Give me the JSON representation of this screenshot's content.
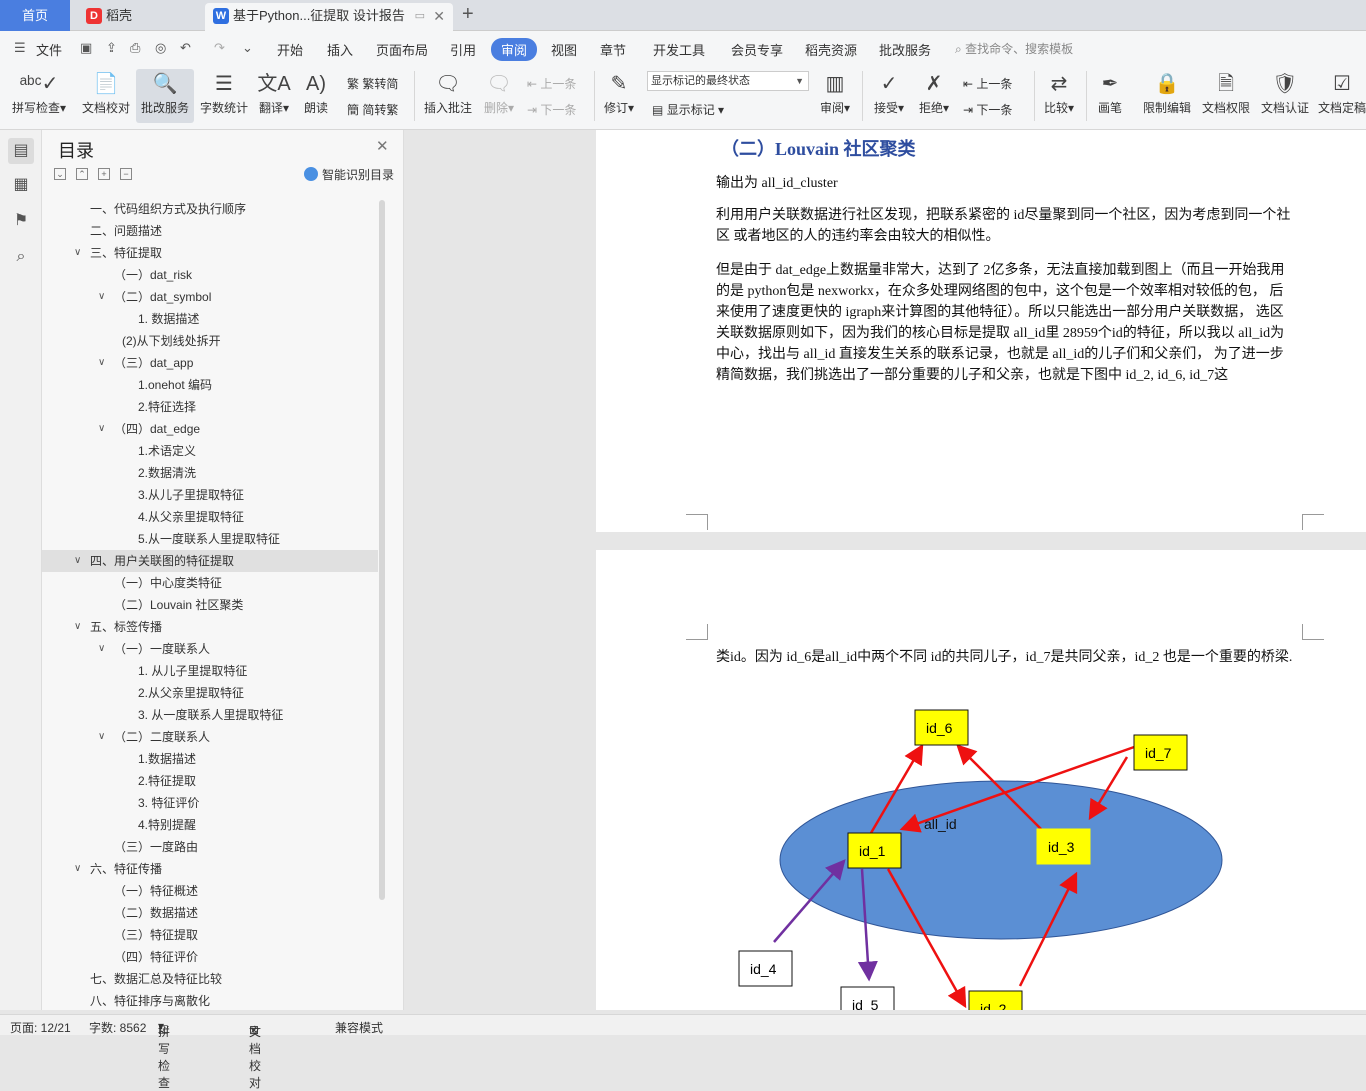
{
  "tabs": {
    "home": "首页",
    "daoke": "稻壳",
    "doc": "基于Python...征提取 设计报告"
  },
  "menu": {
    "file": "文件",
    "items": [
      "开始",
      "插入",
      "页面布局",
      "引用",
      "审阅",
      "视图",
      "章节",
      "开发工具",
      "会员专享",
      "稻壳资源",
      "批改服务"
    ],
    "selected_index": 4,
    "search_placeholder": "查找命令、搜索模板"
  },
  "ribbon": {
    "spell": "拼写检查",
    "proof": "文档校对",
    "correct": "批改服务",
    "wordcount": "字数统计",
    "translate": "翻译",
    "read": "朗读",
    "s2t": "繁转简",
    "t2s": "简转繁",
    "insert_comment": "插入批注",
    "delete": "删除",
    "prev": "上一条",
    "next": "下一条",
    "revise": "修订",
    "markup_state": "显示标记的最终状态",
    "show_markup": "显示标记",
    "review": "审阅",
    "accept": "接受",
    "reject": "拒绝",
    "prev2": "上一条",
    "next2": "下一条",
    "compare": "比较",
    "pen": "画笔",
    "restrict": "限制编辑",
    "perm": "文档权限",
    "cert": "文档认证",
    "final": "文档定稿"
  },
  "toc": {
    "title": "目录",
    "smart": "智能识别目录",
    "items": [
      {
        "t": "一、代码组织方式及执行顺序",
        "l": 1,
        "c": ""
      },
      {
        "t": "二、问题描述",
        "l": 1,
        "c": ""
      },
      {
        "t": "三、特征提取",
        "l": 1,
        "c": "v"
      },
      {
        "t": "（一）dat_risk",
        "l": 2,
        "c": ""
      },
      {
        "t": "（二）dat_symbol",
        "l": 2,
        "c": "v"
      },
      {
        "t": "1. 数据描述",
        "l": 3,
        "c": ""
      },
      {
        "t": "(2)从下划线处拆开",
        "l": 2.5,
        "c": ""
      },
      {
        "t": "（三）dat_app",
        "l": 2,
        "c": "v"
      },
      {
        "t": "1.onehot 编码",
        "l": 3,
        "c": ""
      },
      {
        "t": "2.特征选择",
        "l": 3,
        "c": ""
      },
      {
        "t": "（四）dat_edge",
        "l": 2,
        "c": "v"
      },
      {
        "t": "1.术语定义",
        "l": 3,
        "c": ""
      },
      {
        "t": "2.数据清洗",
        "l": 3,
        "c": ""
      },
      {
        "t": "3.从儿子里提取特征",
        "l": 3,
        "c": ""
      },
      {
        "t": "4.从父亲里提取特征",
        "l": 3,
        "c": ""
      },
      {
        "t": "5.从一度联系人里提取特征",
        "l": 3,
        "c": ""
      },
      {
        "t": "四、用户关联图的特征提取",
        "l": 1,
        "c": "v",
        "hl": true
      },
      {
        "t": "（一）中心度类特征",
        "l": 2,
        "c": ""
      },
      {
        "t": "（二）Louvain 社区聚类",
        "l": 2,
        "c": ""
      },
      {
        "t": "五、标签传播",
        "l": 1,
        "c": "v"
      },
      {
        "t": "（一）一度联系人",
        "l": 2,
        "c": "v"
      },
      {
        "t": "1. 从儿子里提取特征",
        "l": 3,
        "c": ""
      },
      {
        "t": "2.从父亲里提取特征",
        "l": 3,
        "c": ""
      },
      {
        "t": "3. 从一度联系人里提取特征",
        "l": 3,
        "c": ""
      },
      {
        "t": "（二）二度联系人",
        "l": 2,
        "c": "v"
      },
      {
        "t": "1.数据描述",
        "l": 3,
        "c": ""
      },
      {
        "t": "2.特征提取",
        "l": 3,
        "c": ""
      },
      {
        "t": "3. 特征评价",
        "l": 3,
        "c": ""
      },
      {
        "t": "4.特别提醒",
        "l": 3,
        "c": ""
      },
      {
        "t": "（三）一度路由",
        "l": 2,
        "c": ""
      },
      {
        "t": "六、特征传播",
        "l": 1,
        "c": "v"
      },
      {
        "t": "（一）特征概述",
        "l": 2,
        "c": ""
      },
      {
        "t": "（二）数据描述",
        "l": 2,
        "c": ""
      },
      {
        "t": "（三）特征提取",
        "l": 2,
        "c": ""
      },
      {
        "t": "（四）特征评价",
        "l": 2,
        "c": ""
      },
      {
        "t": "七、数据汇总及特征比较",
        "l": 1,
        "c": ""
      },
      {
        "t": "八、特征排序与离散化",
        "l": 1,
        "c": ""
      }
    ]
  },
  "doc": {
    "heading": "（二）Louvain 社区聚类",
    "p0": "输出为 all_id_cluster",
    "p1": "利用用户关联数据进行社区发现，把联系紧密的 id尽量聚到同一个社区，因为考虑到同一个社区 或者地区的人的违约率会由较大的相似性。",
    "p2": "但是由于 dat_edge上数据量非常大，达到了 2亿多条，无法直接加载到图上（而且一开始我用的是 python包是 nexworkx，在众多处理网络图的包中，这个包是一个效率相对较低的包， 后来使用了速度更快的 igraph来计算图的其他特征）。所以只能选出一部分用户关联数据， 选区关联数据原则如下，因为我们的核心目标是提取 all_id里 28959个id的特征，所以我以 all_id为中心，找出与 all_id 直接发生关系的联系记录，也就是 all_id的儿子们和父亲们， 为了进一步精简数据，我们挑选出了一部分重要的儿子和父亲，也就是下图中 id_2, id_6, id_7这",
    "p3": "类id。因为 id_6是all_id中两个不同 id的共同儿子，id_7是共同父亲，id_2 也是一个重要的桥梁.",
    "diagram": {
      "ellipse_label": "all_id",
      "nodes": [
        "id_6",
        "id_7",
        "id_1",
        "id_3",
        "id_4",
        "id_5",
        "id_2"
      ]
    }
  },
  "status": {
    "page": "页面: 12/21",
    "words": "字数: 8562",
    "spell": "拼写检查",
    "proof": "文档校对",
    "compat": "兼容模式"
  },
  "colors": {
    "accent": "#4a7ee0",
    "heading": "#2e4d9f",
    "node_fill": "#ffff00",
    "ellipse": "#5b8fd4",
    "red_arrow": "#ee1111",
    "purple_arrow": "#7030a0"
  }
}
